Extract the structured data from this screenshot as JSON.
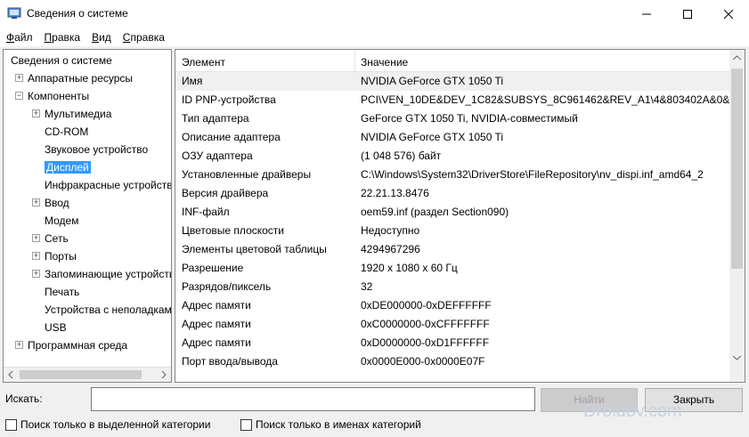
{
  "window": {
    "title": "Сведения о системе"
  },
  "menu": [
    {
      "label": "Файл",
      "key": "Ф",
      "rest": "айл"
    },
    {
      "label": "Правка",
      "key": "П",
      "rest": "равка"
    },
    {
      "label": "Вид",
      "key": "В",
      "rest": "ид"
    },
    {
      "label": "Справка",
      "key": "С",
      "rest": "правка"
    }
  ],
  "tree": {
    "items": [
      {
        "label": "Сведения о системе",
        "level": 0,
        "toggle": ""
      },
      {
        "label": "Аппаратные ресурсы",
        "level": 1,
        "toggle": "+"
      },
      {
        "label": "Компоненты",
        "level": 1,
        "toggle": "−"
      },
      {
        "label": "Мультимедиа",
        "level": 2,
        "toggle": "+"
      },
      {
        "label": "CD-ROM",
        "level": 2,
        "toggle": ""
      },
      {
        "label": "Звуковое устройство",
        "level": 2,
        "toggle": ""
      },
      {
        "label": "Дисплей",
        "level": 2,
        "toggle": "",
        "selected": true
      },
      {
        "label": "Инфракрасные устройства",
        "level": 2,
        "toggle": ""
      },
      {
        "label": "Ввод",
        "level": 2,
        "toggle": "+"
      },
      {
        "label": "Модем",
        "level": 2,
        "toggle": ""
      },
      {
        "label": "Сеть",
        "level": 2,
        "toggle": "+"
      },
      {
        "label": "Порты",
        "level": 2,
        "toggle": "+"
      },
      {
        "label": "Запоминающие устройства",
        "level": 2,
        "toggle": "+"
      },
      {
        "label": "Печать",
        "level": 2,
        "toggle": ""
      },
      {
        "label": "Устройства с неполадками",
        "level": 2,
        "toggle": ""
      },
      {
        "label": "USB",
        "level": 2,
        "toggle": ""
      },
      {
        "label": "Программная среда",
        "level": 1,
        "toggle": "+"
      }
    ]
  },
  "list": {
    "columns": {
      "name": "Элемент",
      "value": "Значение"
    },
    "rows": [
      {
        "name": "Имя",
        "value": "NVIDIA GeForce GTX 1050 Ti"
      },
      {
        "name": "ID PNP-устройства",
        "value": "PCI\\VEN_10DE&DEV_1C82&SUBSYS_8C961462&REV_A1\\4&803402A&0&0"
      },
      {
        "name": "Тип адаптера",
        "value": "GeForce GTX 1050 Ti, NVIDIA-совместимый"
      },
      {
        "name": "Описание адаптера",
        "value": "NVIDIA GeForce GTX 1050 Ti"
      },
      {
        "name": "ОЗУ адаптера",
        "value": "(1 048 576) байт"
      },
      {
        "name": "Установленные драйверы",
        "value": "C:\\Windows\\System32\\DriverStore\\FileRepository\\nv_dispi.inf_amd64_2"
      },
      {
        "name": "Версия драйвера",
        "value": "22.21.13.8476"
      },
      {
        "name": "INF-файл",
        "value": "oem59.inf (раздел Section090)"
      },
      {
        "name": "Цветовые плоскости",
        "value": "Недоступно"
      },
      {
        "name": "Элементы цветовой таблицы",
        "value": "4294967296"
      },
      {
        "name": "Разрешение",
        "value": "1920 x 1080 x 60 Гц"
      },
      {
        "name": "Разрядов/пиксель",
        "value": "32"
      },
      {
        "name": "Адрес памяти",
        "value": "0xDE000000-0xDEFFFFFF"
      },
      {
        "name": "Адрес памяти",
        "value": "0xC0000000-0xCFFFFFFF"
      },
      {
        "name": "Адрес памяти",
        "value": "0xD0000000-0xD1FFFFFF"
      },
      {
        "name": "Порт ввода/вывода",
        "value": "0x0000E000-0x0000E07F"
      }
    ]
  },
  "search": {
    "label": "Искать:",
    "value": "",
    "find_button": "Найти",
    "close_button": "Закрыть",
    "option_selected_category": "Поиск только в выделенной категории",
    "option_category_names": "Поиск только в именах категорий"
  },
  "watermark": "Droidov.com"
}
